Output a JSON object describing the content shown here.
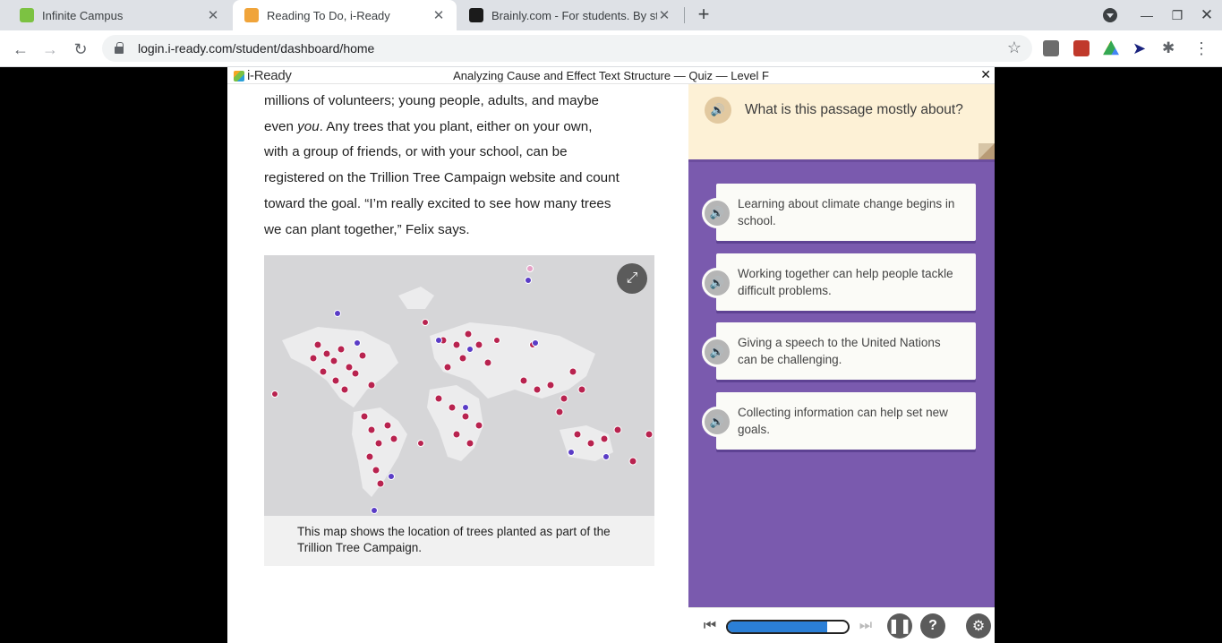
{
  "browser": {
    "tabs": [
      {
        "title": "Infinite Campus",
        "favicon_color": "#7cc242",
        "active": false
      },
      {
        "title": "Reading To Do, i-Ready",
        "favicon_color": "#f0a43a",
        "active": true
      },
      {
        "title": "Brainly.com - For students. By stu",
        "favicon_color": "#1b1b1b",
        "active": false
      }
    ],
    "url": "login.i-ready.com/student/dashboard/home"
  },
  "app": {
    "logo": "i-Ready",
    "quiz_title": "Analyzing Cause and Effect Text Structure — Quiz — Level F"
  },
  "passage": {
    "line1": "millions of volunteers; young people, adults, and maybe",
    "line2a": "even ",
    "line2_em": "you",
    "line2b": ". Any trees that you plant, either on your own,",
    "line3": "with a group of friends, or with your school, can be",
    "line4": "registered on the Trillion Tree Campaign website and count",
    "line5": "toward the goal. “I’m really excited to see how many trees",
    "line6": "we can plant together,” Felix says.",
    "caption": "This map shows the location of trees planted as part of the Trillion Tree Campaign."
  },
  "question": {
    "text": "What is this passage mostly about?",
    "answers": [
      "Learning about climate change begins in school.",
      "Working together can help people tackle difficult problems.",
      "Giving a speech to the United Nations can be challenging.",
      "Collecting information can help set new goals."
    ]
  },
  "player": {
    "progress_percent": 83
  }
}
